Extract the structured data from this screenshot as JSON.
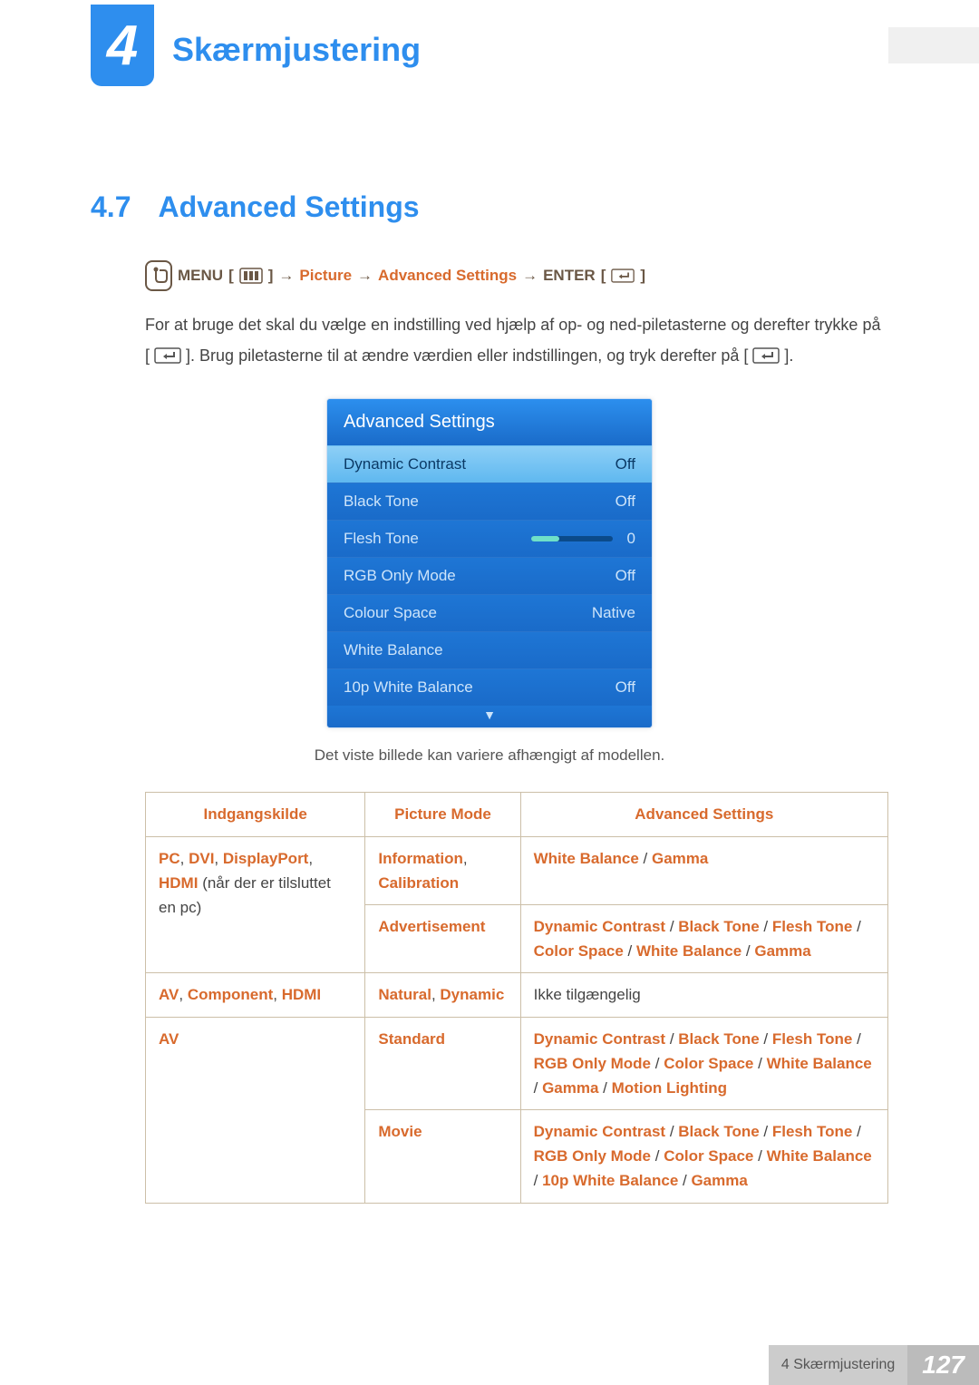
{
  "chapter_number": "4",
  "chapter_title": "Skærmjustering",
  "section": {
    "number": "4.7",
    "title": "Advanced Settings"
  },
  "nav": {
    "menu_label": "MENU",
    "arrow": "→",
    "picture": "Picture",
    "advanced": "Advanced Settings",
    "enter_label": "ENTER"
  },
  "body": {
    "p1_a": "For at bruge det skal du vælge en indstilling ved hjælp af op- og ned-piletasterne og derefter trykke på [",
    "p1_b": "]. Brug piletasterne til at ændre værdien eller indstillingen, og tryk derefter på [",
    "p1_c": "]."
  },
  "osd": {
    "title": "Advanced Settings",
    "items": [
      {
        "label": "Dynamic Contrast",
        "value": "Off",
        "selected": true
      },
      {
        "label": "Black Tone",
        "value": "Off"
      },
      {
        "label": "Flesh Tone",
        "value": "0",
        "slider": true
      },
      {
        "label": "RGB Only Mode",
        "value": "Off"
      },
      {
        "label": "Colour Space",
        "value": "Native"
      },
      {
        "label": "White Balance",
        "value": ""
      },
      {
        "label": "10p White Balance",
        "value": "Off"
      }
    ]
  },
  "caption": "Det viste billede kan variere afhængigt af modellen.",
  "table": {
    "headers": {
      "col1": "Indgangskilde",
      "col2": "Picture Mode",
      "col3": "Advanced Settings"
    },
    "row1": {
      "src_parts": [
        "PC",
        "DVI",
        "DisplayPort",
        "HDMI"
      ],
      "src_suffix": "(når der er tilsluttet en pc)",
      "mode_a_parts": [
        "Information",
        "Calibration"
      ],
      "adv_a_parts": [
        "White Balance",
        "Gamma"
      ],
      "mode_b": "Advertisement",
      "adv_b_parts": [
        "Dynamic Contrast",
        "Black Tone",
        "Flesh Tone",
        "Color Space",
        "White Balance",
        "Gamma"
      ]
    },
    "row2": {
      "src_parts": [
        "AV",
        "Component",
        "HDMI"
      ],
      "mode_parts": [
        "Natural",
        "Dynamic"
      ],
      "adv": "Ikke tilgængelig"
    },
    "row3": {
      "src": "AV",
      "mode_a": "Standard",
      "adv_a_parts": [
        "Dynamic Contrast",
        "Black Tone",
        "Flesh Tone",
        "RGB Only Mode",
        "Color Space",
        "White Balance",
        "Gamma",
        "Motion Lighting"
      ],
      "mode_b": "Movie",
      "adv_b_parts": [
        "Dynamic Contrast",
        "Black Tone",
        "Flesh Tone",
        "RGB Only Mode",
        "Color Space",
        "White Balance",
        "10p White Balance",
        "Gamma"
      ]
    }
  },
  "footer": {
    "text": "4 Skærmjustering",
    "page": "127"
  }
}
